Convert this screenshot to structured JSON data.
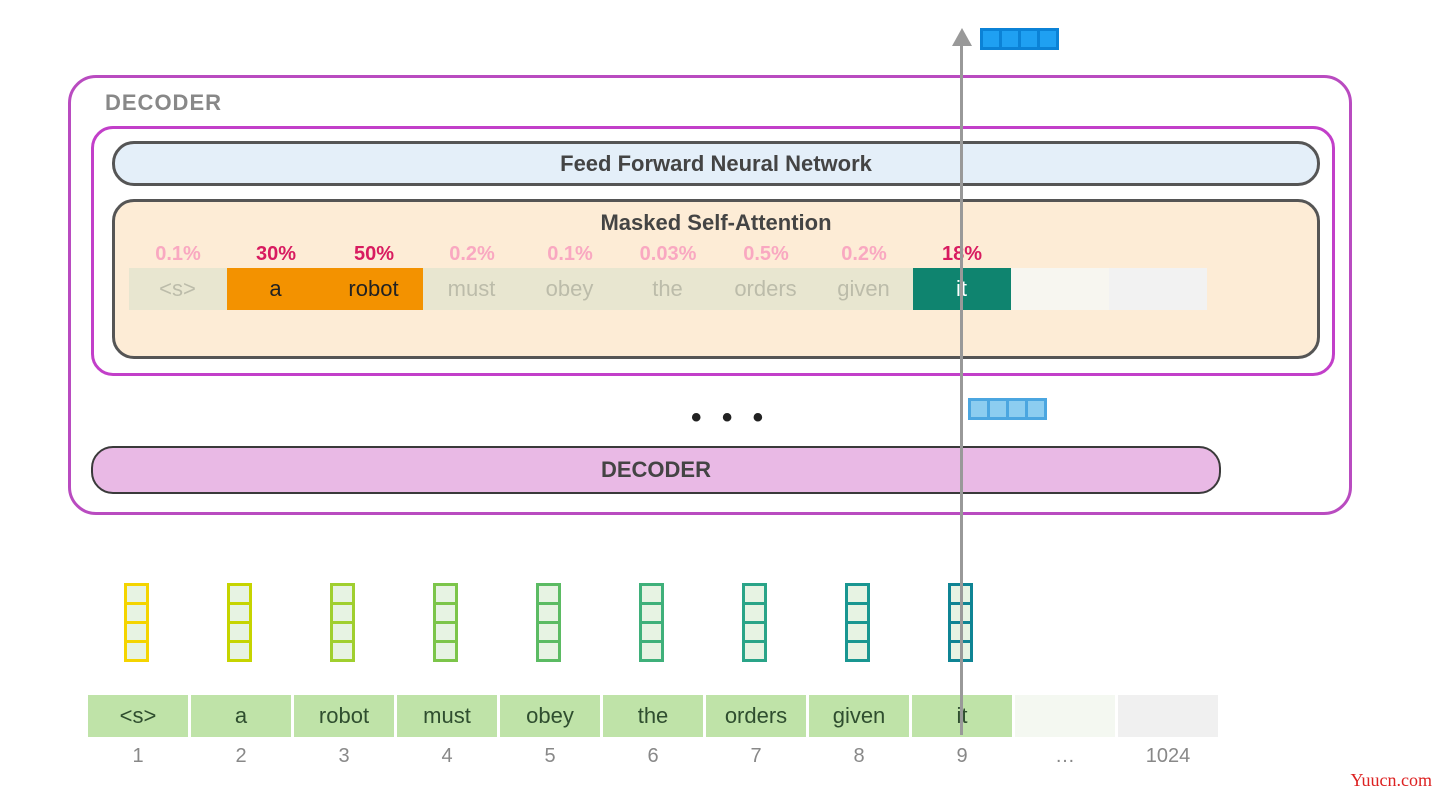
{
  "labels": {
    "decoder_outer": "DECODER",
    "ffn": "Feed Forward Neural Network",
    "msa": "Masked Self-Attention",
    "decoder_bottom": "DECODER",
    "ellipsis": "• • •",
    "ellipsis_pos": "…",
    "watermark": "Yuucn.com"
  },
  "attention": {
    "percents": [
      "0.1%",
      "30%",
      "50%",
      "0.2%",
      "0.1%",
      "0.03%",
      "0.5%",
      "0.2%",
      "18%"
    ],
    "percent_high": [
      false,
      true,
      true,
      false,
      false,
      false,
      false,
      false,
      true
    ],
    "tokens": [
      "<s>",
      "a",
      "robot",
      "must",
      "obey",
      "the",
      "orders",
      "given",
      "it"
    ],
    "token_style": [
      "dim",
      "orange",
      "orange",
      "dim",
      "dim",
      "dim",
      "dim",
      "dim",
      "teal"
    ]
  },
  "input": {
    "tokens": [
      "<s>",
      "a",
      "robot",
      "must",
      "obey",
      "the",
      "orders",
      "given",
      "it"
    ],
    "positions": [
      "1",
      "2",
      "3",
      "4",
      "5",
      "6",
      "7",
      "8",
      "9"
    ],
    "last_pos": "1024"
  },
  "embed_colors": [
    "#f4d400",
    "#c6d400",
    "#a0cf2f",
    "#7cc54a",
    "#5bbb63",
    "#3fb07a",
    "#2aa488",
    "#199691",
    "#0f8494"
  ]
}
